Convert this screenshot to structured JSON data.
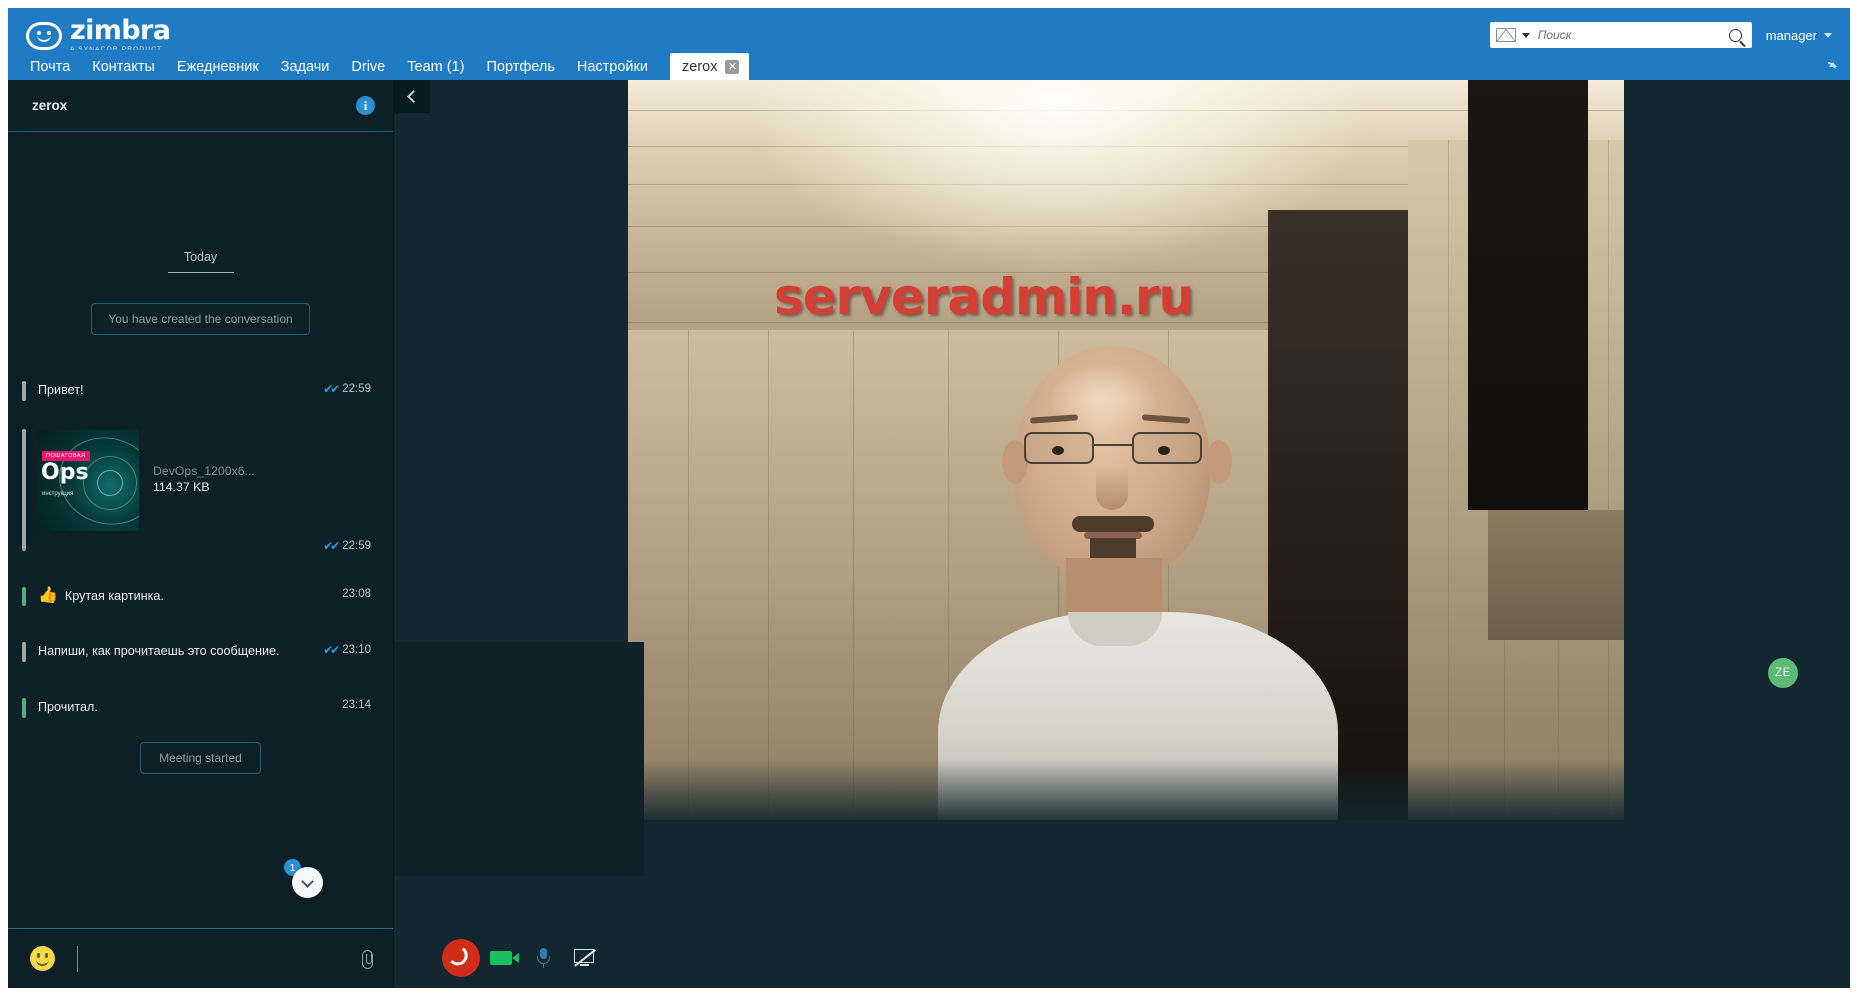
{
  "brand": {
    "name": "zimbra",
    "tagline": "A SYNACOR PRODUCT"
  },
  "topbar": {
    "search": {
      "placeholder": "Поиск",
      "value": "",
      "scope_icon": "envelope-icon",
      "submit_icon": "search-icon"
    },
    "user": {
      "label": "manager",
      "caret_icon": "chevron-down-icon"
    },
    "refresh_icon": "refresh-icon"
  },
  "tabs": [
    {
      "label": "Почта",
      "active": false
    },
    {
      "label": "Контакты",
      "active": false
    },
    {
      "label": "Ежедневник",
      "active": false
    },
    {
      "label": "Задачи",
      "active": false
    },
    {
      "label": "Drive",
      "active": false
    },
    {
      "label": "Team (1)",
      "active": false
    },
    {
      "label": "Портфель",
      "active": false
    },
    {
      "label": "Настройки",
      "active": false
    },
    {
      "label": "zerox",
      "active": true,
      "closable": true,
      "close_icon": "close-icon"
    }
  ],
  "chat": {
    "title": "zerox",
    "info_icon": "info-icon",
    "collapse_icon": "chevron-left-icon",
    "day_divider": "Today",
    "system_message": "You have created the conversation",
    "messages": [
      {
        "kind": "text",
        "direction": "out",
        "text": "Привет!",
        "time": "22:59",
        "ticks": "✔✔"
      },
      {
        "kind": "attachment",
        "direction": "out",
        "file_name": "DevOps_1200x6...",
        "file_size": "114.37 KB",
        "thumb_tag": "ПОШАГОВАЯ",
        "thumb_title": "Ops",
        "thumb_sub": "инструкция",
        "time": "22:59",
        "ticks": "✔✔"
      },
      {
        "kind": "text",
        "direction": "in",
        "emoji": "👍",
        "text": "Крутая картинка.",
        "time": "23:08",
        "ticks": ""
      },
      {
        "kind": "text",
        "direction": "out",
        "text": "Напиши, как прочитаешь это сообщение.",
        "time": "23:10",
        "ticks": "✔✔"
      },
      {
        "kind": "text",
        "direction": "in",
        "text": "Прочитал.",
        "time": "23:14",
        "ticks": ""
      }
    ],
    "meeting_chip": "Meeting started",
    "scroll_badge": "1",
    "scroll_icon": "chevron-down-icon",
    "composer": {
      "emoji_icon": "smiley-icon",
      "placeholder": "",
      "value": "",
      "attach_icon": "paperclip-icon"
    }
  },
  "video": {
    "watermark": "serveradmin.ru",
    "remote_avatar": "ZE",
    "avatar_color": "#5fb978",
    "controls": {
      "hangup_icon": "hangup-icon",
      "camera_icon": "camera-icon",
      "microphone_icon": "microphone-icon",
      "screenshare_off_icon": "screen-share-off-icon"
    }
  }
}
